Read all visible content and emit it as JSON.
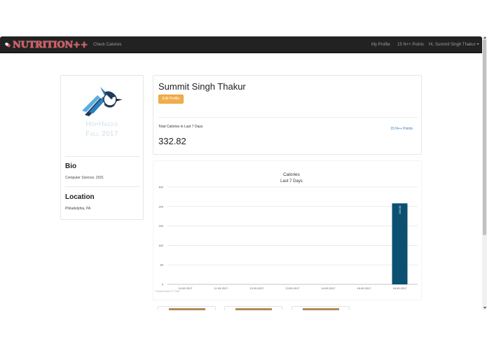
{
  "navbar": {
    "brand": "NUTRITION++",
    "check_calories": "Check Calories",
    "my_profile": "My Profile",
    "points": "15 N++ Points",
    "greeting": "Hi, Summit Singh Thakur"
  },
  "profile": {
    "logo_line1": "HopHacks",
    "logo_line2": "Fall 2017",
    "bio_title": "Bio",
    "bio_text": "Computer Science, 2021",
    "location_title": "Location",
    "location_text": "Philadelphia, PA"
  },
  "summary": {
    "name": "Summit Singh Thakur",
    "edit_button": "Edit Profile",
    "total_label": "Total Calories in Last 7 Days",
    "total_value": "332.82",
    "points_link": "15 N++ Points"
  },
  "chart_data": {
    "type": "bar",
    "title": "Calories",
    "subtitle": "Last 7 Days",
    "categories": [
      "10.09.2017",
      "11.09.2017",
      "12.09.2017",
      "13.09.2017",
      "14.09.2017",
      "15.09.2017",
      "16.09.2017"
    ],
    "values": [
      0,
      0,
      0,
      0,
      0,
      0,
      332.82
    ],
    "value_labels": [
      "",
      "",
      "",
      "",
      "",
      "",
      "332.82"
    ],
    "ylim": [
      0,
      400
    ],
    "yticks": [
      "0",
      "80",
      "160",
      "240",
      "320",
      "400"
    ],
    "grid": true,
    "bar_color": "#0b4f71",
    "credit": "FusionCharts XT Trial"
  },
  "colors": {
    "navbar_bg": "#222222",
    "brand": "#e8505b",
    "edit_button": "#f0ad4e",
    "link": "#337ab7"
  }
}
